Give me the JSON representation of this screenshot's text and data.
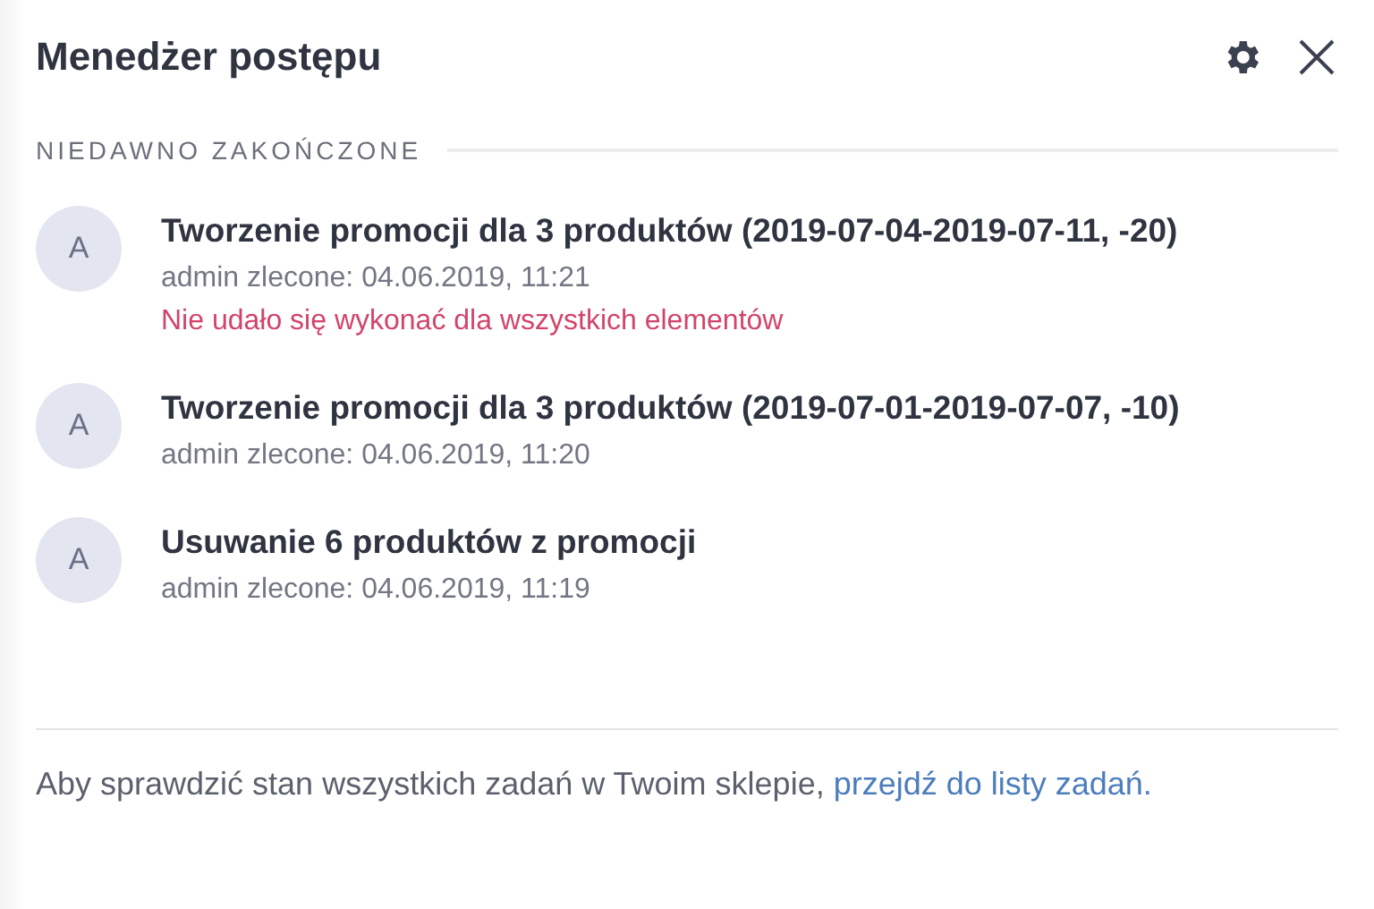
{
  "panel": {
    "title": "Menedżer postępu"
  },
  "section": {
    "heading": "NIEDAWNO ZAKOŃCZONE"
  },
  "tasks": [
    {
      "avatar": "A",
      "title": "Tworzenie promocji dla 3 produktów (2019-07-04-2019-07-11, -20)",
      "meta": "admin zlecone: 04.06.2019, 11:21",
      "error": "Nie udało się wykonać dla wszystkich elementów"
    },
    {
      "avatar": "A",
      "title": "Tworzenie promocji dla 3 produktów (2019-07-01-2019-07-07, -10)",
      "meta": "admin zlecone: 04.06.2019, 11:20"
    },
    {
      "avatar": "A",
      "title": "Usuwanie 6 produktów z promocji",
      "meta": "admin zlecone: 04.06.2019, 11:19"
    }
  ],
  "footer": {
    "text": "Aby sprawdzić stan wszystkich zadań w Twoim sklepie,",
    "link": "przejdź do listy zadań."
  }
}
